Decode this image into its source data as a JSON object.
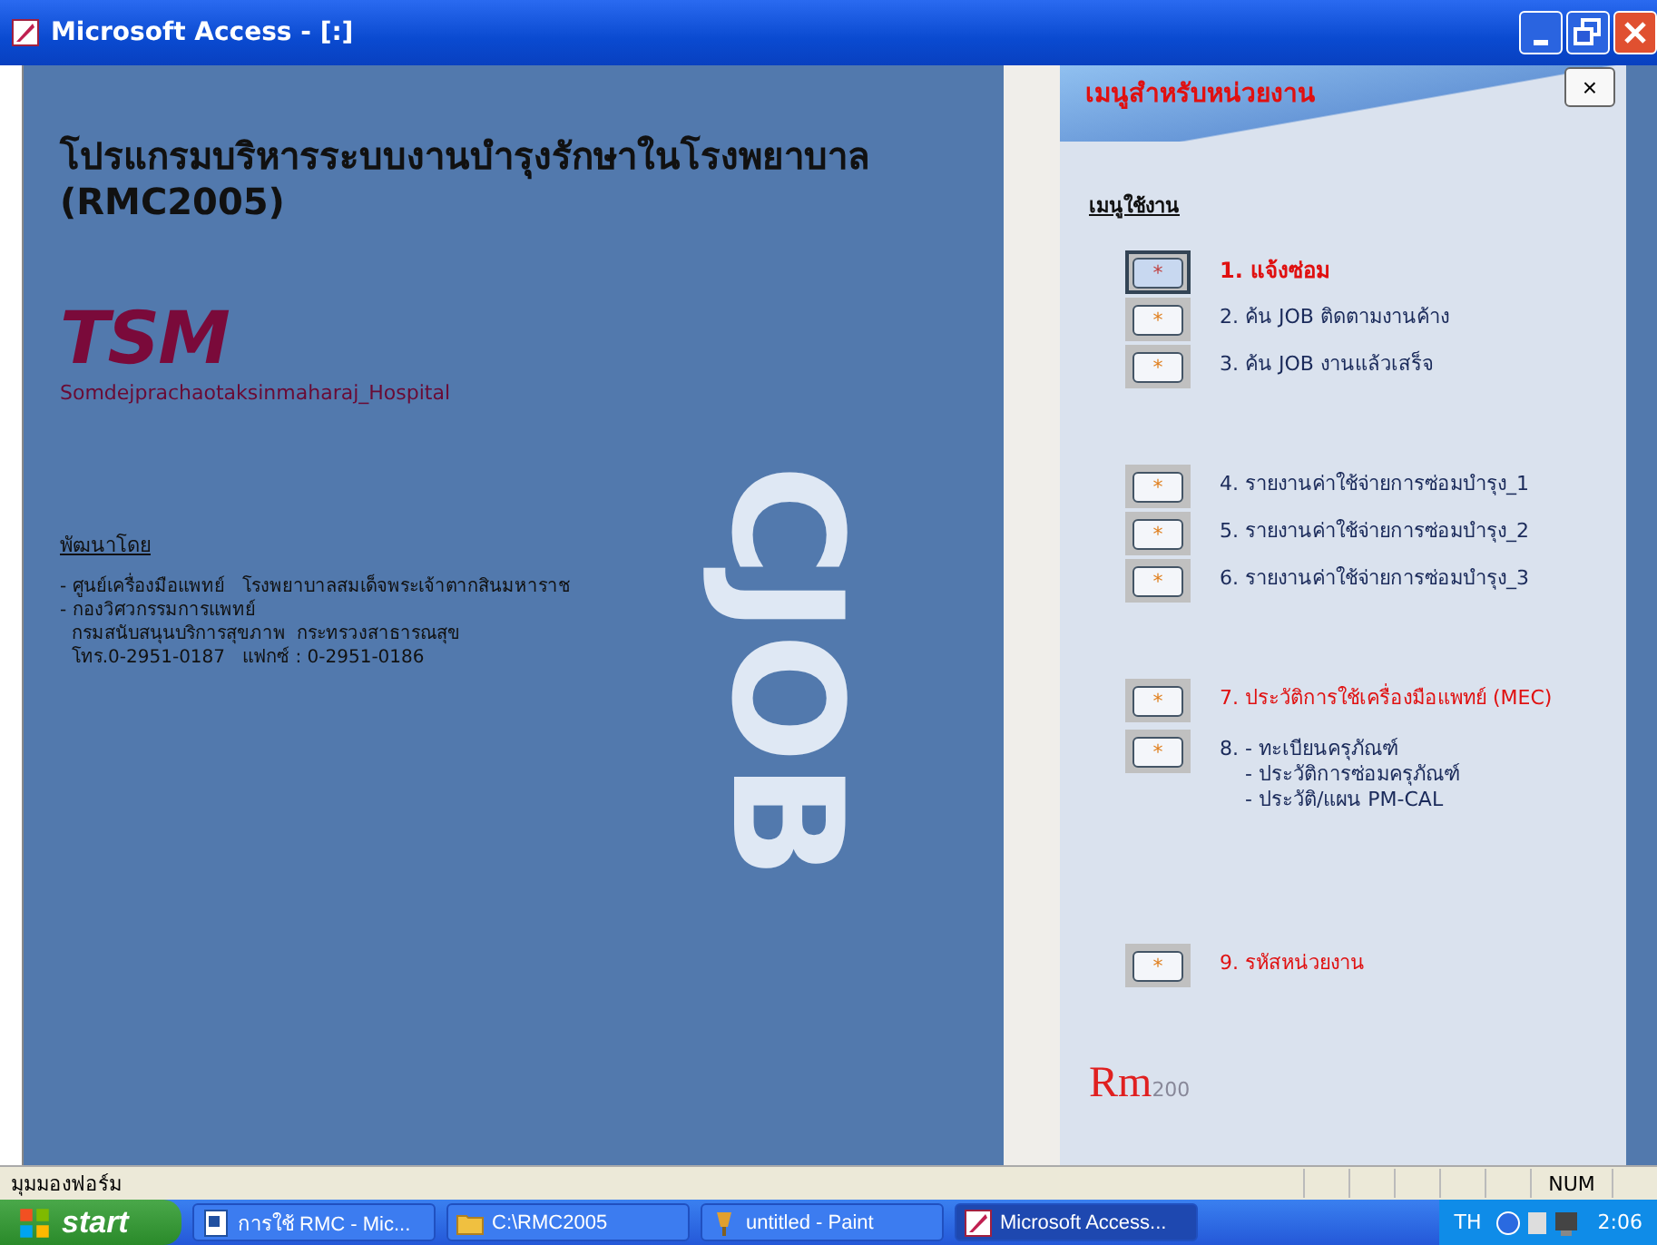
{
  "window": {
    "title": "Microsoft Access - [:]"
  },
  "left_panel": {
    "heading": "โปรแกรมบริหารระบบงานบำรุงรักษาในโรงพยาบาล (RMC2005)",
    "logo": "TSM",
    "hospital": "Somdejprachaotaksinmaharaj_Hospital",
    "side_logo": "CJOB",
    "developed_by": "พัฒนาโดย",
    "credits": [
      "- ศูนย์เครื่องมือแพทย์   โรงพยาบาลสมเด็จพระเจ้าตากสินมหาราช",
      "- กองวิศวกรรมการแพทย์",
      "  กรมสนับสนุนบริการสุขภาพ  กระทรวงสาธารณสุข",
      "  โทร.0-2951-0187   แฟกซ์ : 0-2951-0186"
    ]
  },
  "menu_panel": {
    "title": "เมนูสำหรับหน่วยงาน",
    "close": "×",
    "section": "เมนูใช้งาน",
    "groups": [
      [
        {
          "lines": [
            "1. แจ้งซ่อม"
          ],
          "button": "*",
          "selected": true,
          "color": "#e01010"
        },
        {
          "lines": [
            "2. ค้น JOB ติดตามงานค้าง"
          ],
          "button": "*",
          "selected": false,
          "color": "#1a2a5a"
        },
        {
          "lines": [
            "3. ค้น JOB งานแล้วเสร็จ"
          ],
          "button": "*",
          "selected": false,
          "color": "#1a2a5a"
        }
      ],
      [
        {
          "lines": [
            "4. รายงานค่าใช้จ่ายการซ่อมบำรุง_1"
          ],
          "button": "*",
          "selected": false,
          "color": "#1a2a5a"
        },
        {
          "lines": [
            "5. รายงานค่าใช้จ่ายการซ่อมบำรุง_2"
          ],
          "button": "*",
          "selected": false,
          "color": "#1a2a5a"
        },
        {
          "lines": [
            "6. รายงานค่าใช้จ่ายการซ่อมบำรุง_3"
          ],
          "button": "*",
          "selected": false,
          "color": "#1a2a5a"
        }
      ],
      [
        {
          "lines": [
            "7. ประวัติการใช้เครื่องมือแพทย์ (MEC)"
          ],
          "button": "*",
          "selected": false,
          "color": "#e01010"
        },
        {
          "lines": [
            "8. - ทะเบียนครุภัณฑ์",
            "    - ประวัติการซ่อมครุภัณฑ์",
            "    - ประวัติ/แผน PM-CAL"
          ],
          "button": "*",
          "selected": false,
          "color": "#1a2a5a"
        }
      ],
      [
        {
          "lines": [
            "9. รหัสหน่วยงาน"
          ],
          "button": "*",
          "selected": false,
          "color": "#e01010"
        }
      ]
    ],
    "footer_logo": {
      "mark": "Rm",
      "year": "200"
    }
  },
  "status_bar": {
    "text": "มุมมองฟอร์ม",
    "indicator": "NUM"
  },
  "taskbar": {
    "start": "start",
    "items": [
      {
        "label": "การใช้ RMC - Mic...",
        "kind": "document",
        "selected": false
      },
      {
        "label": "C:\\RMC2005",
        "kind": "folder",
        "selected": false
      },
      {
        "label": "untitled - Paint",
        "kind": "paint",
        "selected": false
      },
      {
        "label": "Microsoft Access...",
        "kind": "access",
        "selected": true
      }
    ],
    "language": "TH",
    "clock": "2:06"
  }
}
